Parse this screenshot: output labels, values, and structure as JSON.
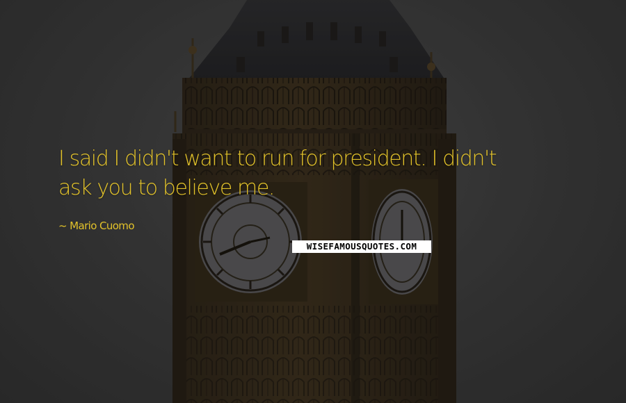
{
  "quote": {
    "line1": "I said I didn't want to run for president. I didn't",
    "line2": "ask you to believe me."
  },
  "author": "~ Mario Cuomo",
  "watermark": "WISEFAMOUSQUOTES.COM",
  "colors": {
    "quote_text": "#e2c22a",
    "background": "#3d3d3d",
    "watermark_bg": "#ffffff",
    "watermark_text": "#000000"
  }
}
